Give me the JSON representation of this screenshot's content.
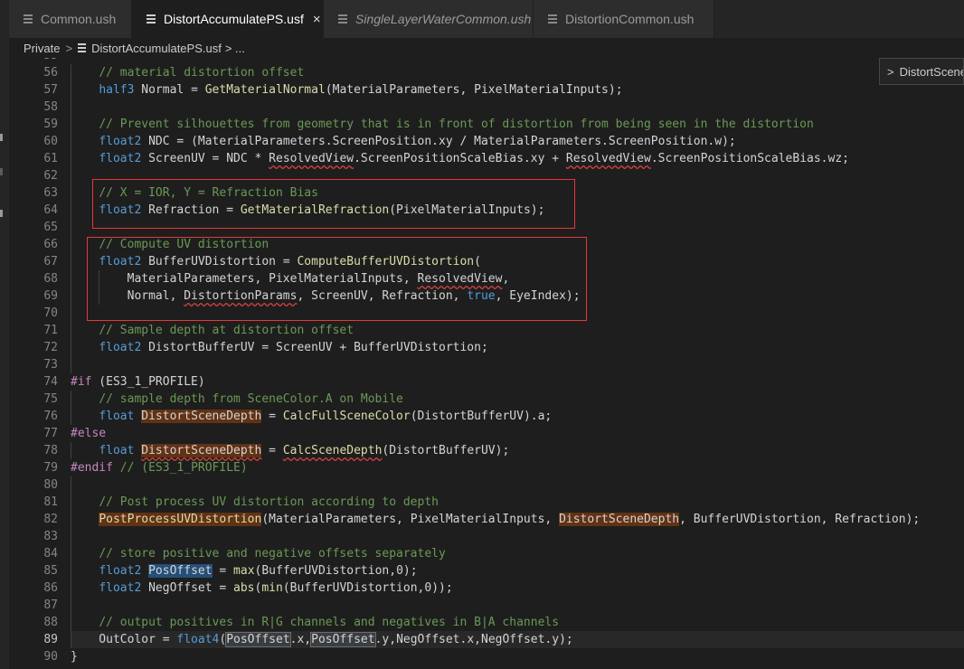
{
  "tabs": [
    {
      "label": "Common.ush",
      "active": false,
      "italic": false
    },
    {
      "label": "DistortAccumulatePS.usf",
      "active": true,
      "italic": false,
      "close": "×"
    },
    {
      "label": "SingleLayerWaterCommon.ush",
      "active": false,
      "italic": true
    },
    {
      "label": "DistortionCommon.ush",
      "active": false,
      "italic": false
    }
  ],
  "breadcrumb": {
    "folder": "Private",
    "separator": ">",
    "file": "DistortAccumulatePS.usf",
    "trail": "> ..."
  },
  "sticky_widget": {
    "chevron": ">",
    "label": "DistortSceneDepth"
  },
  "editor": {
    "partial_top_line": "55",
    "lines": [
      {
        "n": "56",
        "text": "    // material distortion offset"
      },
      {
        "n": "57",
        "text": "    half3 Normal = GetMaterialNormal(MaterialParameters, PixelMaterialInputs);"
      },
      {
        "n": "58",
        "text": ""
      },
      {
        "n": "59",
        "text": "    // Prevent silhouettes from geometry that is in front of distortion from being seen in the distortion"
      },
      {
        "n": "60",
        "text": "    float2 NDC = (MaterialParameters.ScreenPosition.xy / MaterialParameters.ScreenPosition.w);"
      },
      {
        "n": "61",
        "text": "    float2 ScreenUV = NDC * ResolvedView.ScreenPositionScaleBias.xy + ResolvedView.ScreenPositionScaleBias.wz;"
      },
      {
        "n": "62",
        "text": ""
      },
      {
        "n": "63",
        "text": "    // X = IOR, Y = Refraction Bias"
      },
      {
        "n": "64",
        "text": "    float2 Refraction = GetMaterialRefraction(PixelMaterialInputs);"
      },
      {
        "n": "65",
        "text": ""
      },
      {
        "n": "66",
        "text": "    // Compute UV distortion"
      },
      {
        "n": "67",
        "text": "    float2 BufferUVDistortion = ComputeBufferUVDistortion("
      },
      {
        "n": "68",
        "text": "        MaterialParameters, PixelMaterialInputs, ResolvedView,"
      },
      {
        "n": "69",
        "text": "        Normal, DistortionParams, ScreenUV, Refraction, true, EyeIndex);"
      },
      {
        "n": "70",
        "text": ""
      },
      {
        "n": "71",
        "text": "    // Sample depth at distortion offset"
      },
      {
        "n": "72",
        "text": "    float2 DistortBufferUV = ScreenUV + BufferUVDistortion;"
      },
      {
        "n": "73",
        "text": ""
      },
      {
        "n": "74",
        "text": "#if (ES3_1_PROFILE)"
      },
      {
        "n": "75",
        "text": "    // sample depth from SceneColor.A on Mobile"
      },
      {
        "n": "76",
        "text": "    float DistortSceneDepth = CalcFullSceneColor(DistortBufferUV).a;"
      },
      {
        "n": "77",
        "text": "#else"
      },
      {
        "n": "78",
        "text": "    float DistortSceneDepth = CalcSceneDepth(DistortBufferUV);"
      },
      {
        "n": "79",
        "text": "#endif // (ES3_1_PROFILE)"
      },
      {
        "n": "80",
        "text": ""
      },
      {
        "n": "81",
        "text": "    // Post process UV distortion according to depth"
      },
      {
        "n": "82",
        "text": "    PostProcessUVDistortion(MaterialParameters, PixelMaterialInputs, DistortSceneDepth, BufferUVDistortion, Refraction);"
      },
      {
        "n": "83",
        "text": ""
      },
      {
        "n": "84",
        "text": "    // store positive and negative offsets separately"
      },
      {
        "n": "85",
        "text": "    float2 PosOffset = max(BufferUVDistortion,0);"
      },
      {
        "n": "86",
        "text": "    float2 NegOffset = abs(min(BufferUVDistortion,0));"
      },
      {
        "n": "87",
        "text": ""
      },
      {
        "n": "88",
        "text": "    // output positives in R|G channels and negatives in B|A channels"
      },
      {
        "n": "89",
        "text": "    OutColor = float4(PosOffset.x,PosOffset.y,NegOffset.x,NegOffset.y);"
      },
      {
        "n": "90",
        "text": "}"
      }
    ],
    "current_line": "89",
    "annotation_boxes": [
      {
        "label": "refraction-input-box",
        "from_line": "63",
        "to_line": "64"
      },
      {
        "label": "compute-uv-distortion-box",
        "from_line": "66",
        "to_line": "70"
      }
    ],
    "colors": {
      "background": "#1e1e1e",
      "comment": "#6a9955",
      "keyword": "#569cd6",
      "function": "#dcdcaa",
      "preprocessor": "#c586c0",
      "annotation_box": "#e53935",
      "reference_highlight": "#613214",
      "selection_highlight": "#264f78"
    }
  }
}
